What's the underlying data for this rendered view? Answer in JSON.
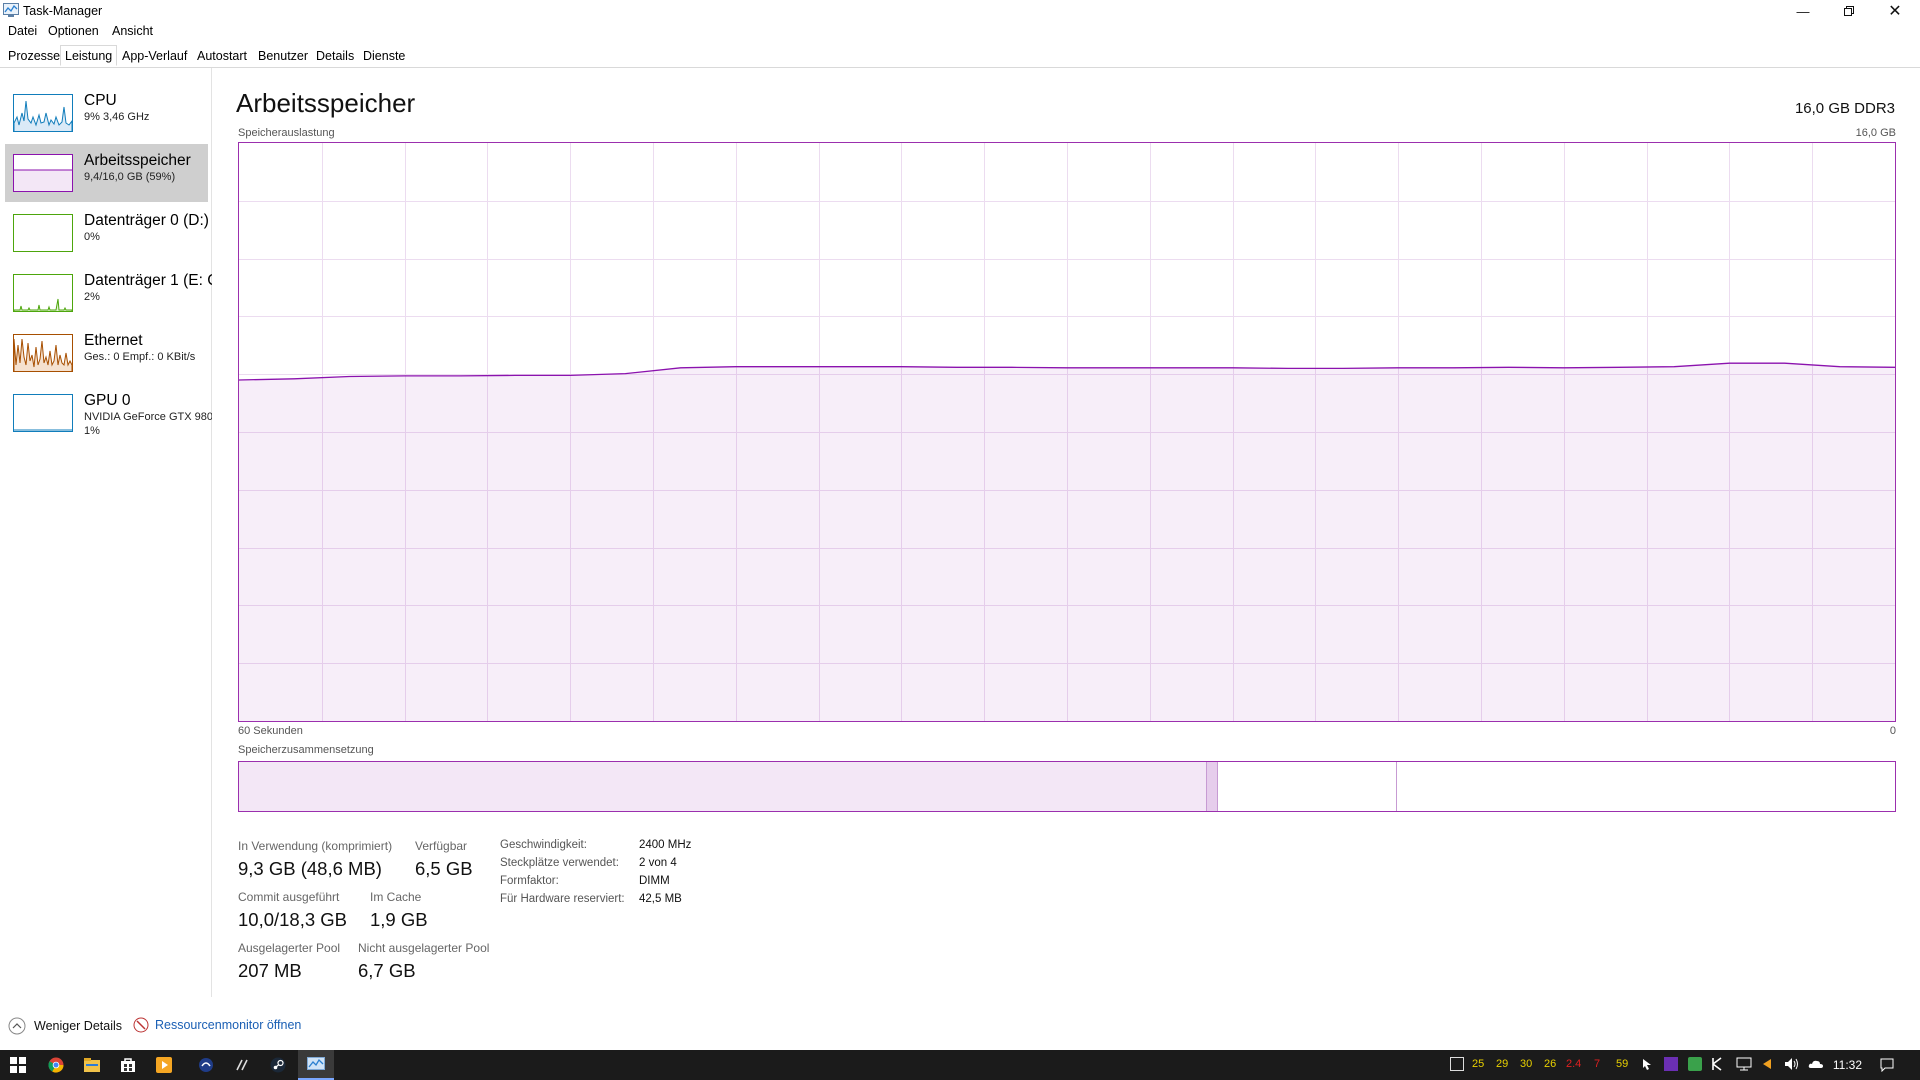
{
  "window": {
    "title": "Task-Manager"
  },
  "menu": {
    "items": [
      "Datei",
      "Optionen",
      "Ansicht"
    ]
  },
  "tabs": [
    "Prozesse",
    "Leistung",
    "App-Verlauf",
    "Autostart",
    "Benutzer",
    "Details",
    "Dienste"
  ],
  "active_tab": "Leistung",
  "sidebar": {
    "items": [
      {
        "title": "CPU",
        "sub": "9%  3,46 GHz",
        "sub2": "",
        "color": "#117dbb",
        "selected": false
      },
      {
        "title": "Arbeitsspeicher",
        "sub": "9,4/16,0 GB (59%)",
        "sub2": "",
        "color": "#8b12ae",
        "selected": true
      },
      {
        "title": "Datenträger 0 (D:)",
        "sub": "0%",
        "sub2": "",
        "color": "#4da60c",
        "selected": false
      },
      {
        "title": "Datenträger 1 (E: C",
        "sub": "2%",
        "sub2": "",
        "color": "#4da60c",
        "selected": false
      },
      {
        "title": "Ethernet",
        "sub": "Ges.: 0  Empf.: 0 KBit/s",
        "sub2": "",
        "color": "#a74f01",
        "selected": false
      },
      {
        "title": "GPU 0",
        "sub": "NVIDIA GeForce GTX 980",
        "sub2": "1%",
        "color": "#117dbb",
        "selected": false
      }
    ]
  },
  "main": {
    "title": "Arbeitsspeicher",
    "spec": "16,0 GB DDR3",
    "graph_label": "Speicherauslastung",
    "graph_max": "16,0 GB",
    "graph_left_label": "60 Sekunden",
    "graph_right_label": "0",
    "usage_line_percent": [
      59,
      59.2,
      59.6,
      59.7,
      59.7,
      59.8,
      59.8,
      60.1,
      61.1,
      61.3,
      61.3,
      61.3,
      61.3,
      61.2,
      61.2,
      61.1,
      61.1,
      61.1,
      61.1,
      61.0,
      61.0,
      61.1,
      61.1,
      61.2,
      61.1,
      61.2,
      61.3,
      61.9,
      61.9,
      61.3,
      61.2
    ],
    "composition_label": "Speicherzusammensetzung",
    "composition_segments_percent": {
      "in_use": 58.4,
      "modified": 0.7,
      "standby": 10.8,
      "free": 30.1
    },
    "stats": {
      "in_use_label": "In Verwendung (komprimiert)",
      "in_use_value": "9,3 GB (48,6 MB)",
      "available_label": "Verfügbar",
      "available_value": "6,5 GB",
      "committed_label": "Commit ausgeführt",
      "committed_value": "10,0/18,3 GB",
      "cached_label": "Im Cache",
      "cached_value": "1,9 GB",
      "paged_label": "Ausgelagerter Pool",
      "paged_value": "207 MB",
      "nonpaged_label": "Nicht ausgelagerter Pool",
      "nonpaged_value": "6,7 GB"
    },
    "details": {
      "speed_label": "Geschwindigkeit:",
      "speed_value": "2400 MHz",
      "slots_label": "Steckplätze verwendet:",
      "slots_value": "2 von 4",
      "form_label": "Formfaktor:",
      "form_value": "DIMM",
      "reserved_label": "Für Hardware reserviert:",
      "reserved_value": "42,5 MB"
    }
  },
  "footer": {
    "fewer_details": "Weniger Details",
    "resmon": "Ressourcenmonitor öffnen"
  },
  "taskbar": {
    "tray_numbers": [
      {
        "text": "25",
        "color": "#e8d000"
      },
      {
        "text": "29",
        "color": "#e8d000"
      },
      {
        "text": "30",
        "color": "#e8d000"
      },
      {
        "text": "26",
        "color": "#e8d000"
      },
      {
        "text": "2.4",
        "color": "#e02020"
      },
      {
        "text": "7",
        "color": "#e02020"
      },
      {
        "text": "59",
        "color": "#e8d000"
      }
    ],
    "clock": "11:32"
  }
}
